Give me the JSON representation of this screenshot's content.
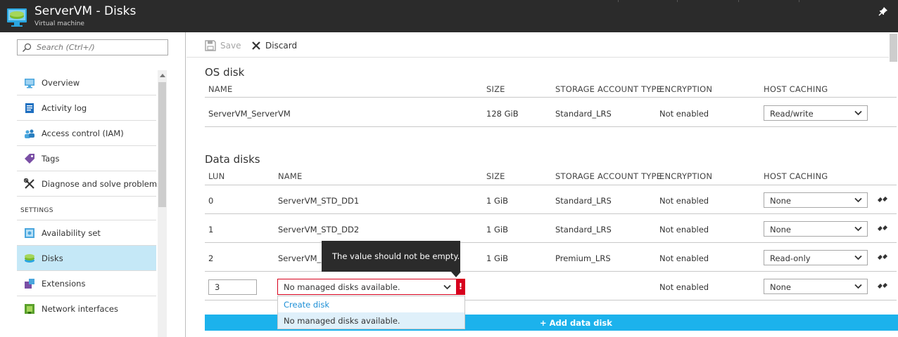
{
  "header": {
    "title": "ServerVM - Disks",
    "subtitle": "Virtual machine"
  },
  "sidebar": {
    "search_placeholder": "Search (Ctrl+/)",
    "items": [
      {
        "label": "Overview",
        "icon": "monitor-icon"
      },
      {
        "label": "Activity log",
        "icon": "log-icon"
      },
      {
        "label": "Access control (IAM)",
        "icon": "people-icon"
      },
      {
        "label": "Tags",
        "icon": "tag-icon"
      },
      {
        "label": "Diagnose and solve problems",
        "icon": "wrench-icon"
      }
    ],
    "section_settings": "SETTINGS",
    "settings_items": [
      {
        "label": "Availability set",
        "icon": "availability-set-icon"
      },
      {
        "label": "Disks",
        "icon": "disks-icon",
        "active": true
      },
      {
        "label": "Extensions",
        "icon": "extensions-icon"
      },
      {
        "label": "Network interfaces",
        "icon": "network-icon"
      }
    ]
  },
  "toolbar": {
    "save_label": "Save",
    "discard_label": "Discard"
  },
  "os_disk": {
    "title": "OS disk",
    "columns": [
      "NAME",
      "SIZE",
      "STORAGE ACCOUNT TYPE",
      "ENCRYPTION",
      "HOST CACHING"
    ],
    "row": {
      "name": "ServerVM_ServerVM",
      "size": "128 GiB",
      "storage": "Standard_LRS",
      "encryption": "Not enabled",
      "caching": "Read/write"
    }
  },
  "data_disks": {
    "title": "Data disks",
    "columns": [
      "LUN",
      "NAME",
      "SIZE",
      "STORAGE ACCOUNT TYPE",
      "ENCRYPTION",
      "HOST CACHING"
    ],
    "rows": [
      {
        "lun": "0",
        "name": "ServerVM_STD_DD1",
        "size": "1 GiB",
        "storage": "Standard_LRS",
        "encryption": "Not enabled",
        "caching": "None"
      },
      {
        "lun": "1",
        "name": "ServerVM_STD_DD2",
        "size": "1 GiB",
        "storage": "Standard_LRS",
        "encryption": "Not enabled",
        "caching": "None"
      },
      {
        "lun": "2",
        "name": "ServerVM_P",
        "size": "1 GiB",
        "storage": "Premium_LRS",
        "encryption": "Not enabled",
        "caching": "Read-only"
      }
    ],
    "new_row": {
      "lun": "3",
      "name_selected": "No managed disks available.",
      "encryption": "Not enabled",
      "caching": "None"
    },
    "tooltip": "The value should not be empty.",
    "error_mark": "!",
    "dropdown_options": [
      "Create disk",
      "No managed disks available."
    ],
    "add_button": "+ Add data disk"
  },
  "colors": {
    "header_bg": "#2b2b2b",
    "active_nav": "#c5e8f7",
    "accent": "#1cb2ec",
    "error": "#d7001d",
    "link": "#1c8fd6"
  }
}
